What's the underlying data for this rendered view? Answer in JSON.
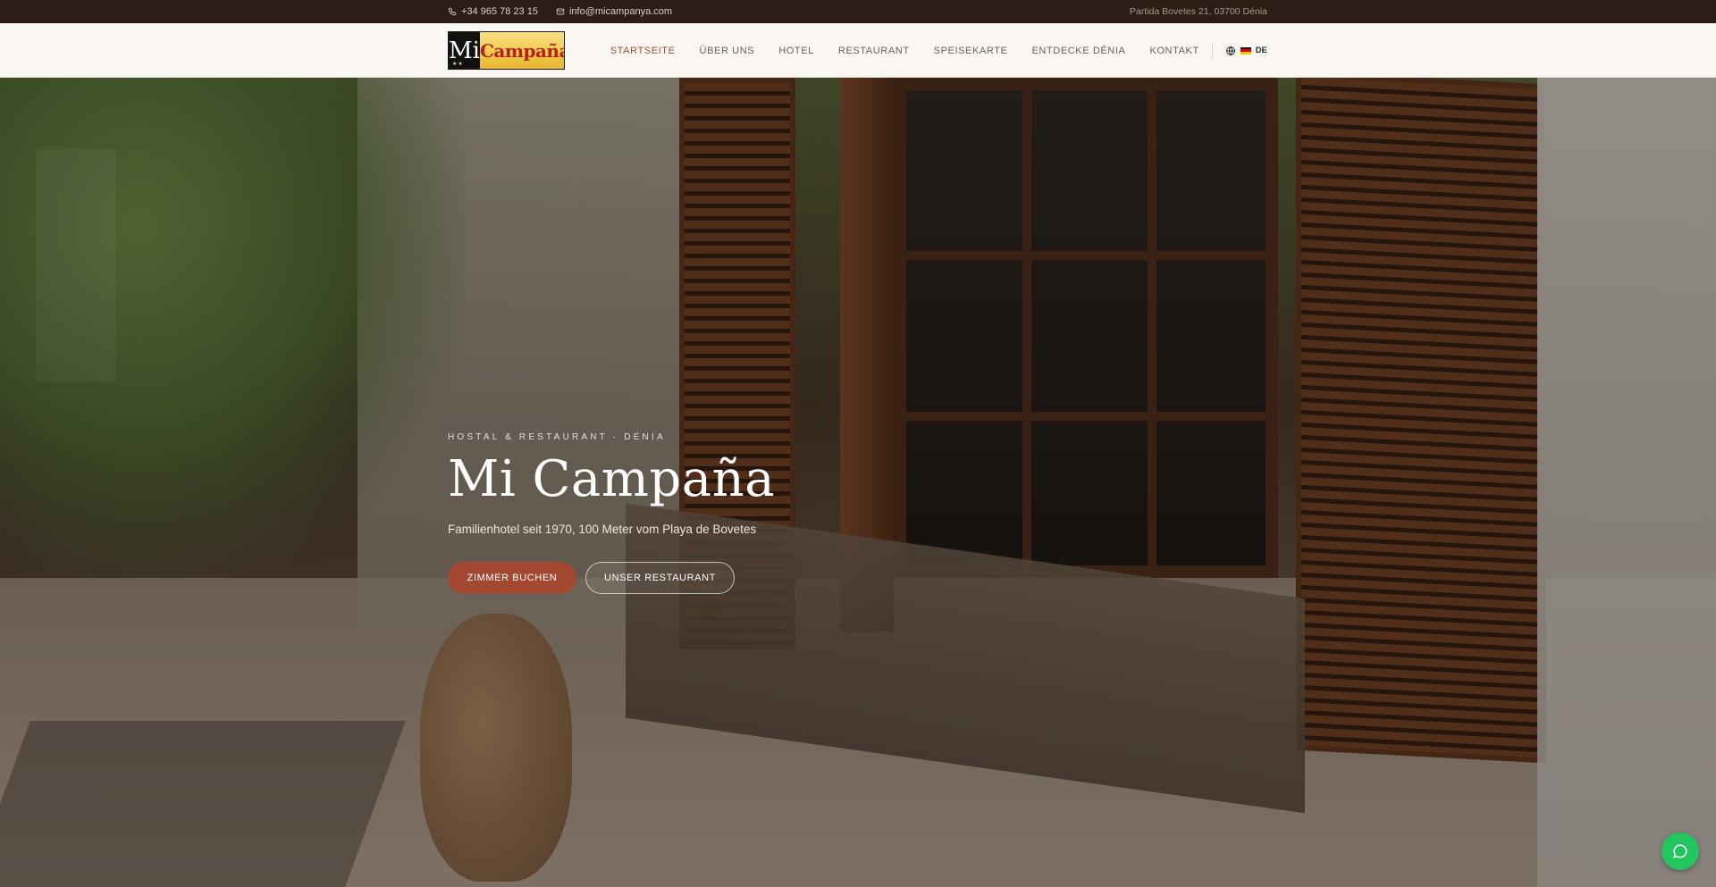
{
  "topbar": {
    "phone": "+34 965 78 23 15",
    "email": "info@micampanya.com",
    "address": "Partida Bovetes 21, 03700 Dénia",
    "icons": {
      "phone": "phone-icon",
      "email": "mail-icon"
    }
  },
  "header": {
    "logo": {
      "mi": "Mi",
      "campana": "Campaña",
      "stars": "★★"
    },
    "nav": [
      {
        "label": "STARTSEITE",
        "active": true
      },
      {
        "label": "ÜBER UNS",
        "active": false
      },
      {
        "label": "HOTEL",
        "active": false
      },
      {
        "label": "RESTAURANT",
        "active": false
      },
      {
        "label": "SPEISEKARTE",
        "active": false
      },
      {
        "label": "ENTDECKE DÉNIA",
        "active": false
      },
      {
        "label": "KONTAKT",
        "active": false
      }
    ],
    "language": {
      "code": "DE",
      "icon": "globe-icon"
    }
  },
  "hero": {
    "eyebrow": "HOSTAL & RESTAURANT · DENIA",
    "title": "Mi Campaña",
    "subtitle": "Familienhotel seit 1970, 100 Meter vom Playa de Bovetes",
    "buttons": {
      "primary": "ZIMMER BUCHEN",
      "secondary": "UNSER RESTAURANT"
    }
  },
  "chat": {
    "icon": "chat-bubble-icon"
  },
  "colors": {
    "topbar_bg": "#2b1e16",
    "header_bg": "#faf7f3",
    "accent": "#a34731",
    "nav_active": "#a14a34",
    "chat_button": "#22c55e"
  }
}
